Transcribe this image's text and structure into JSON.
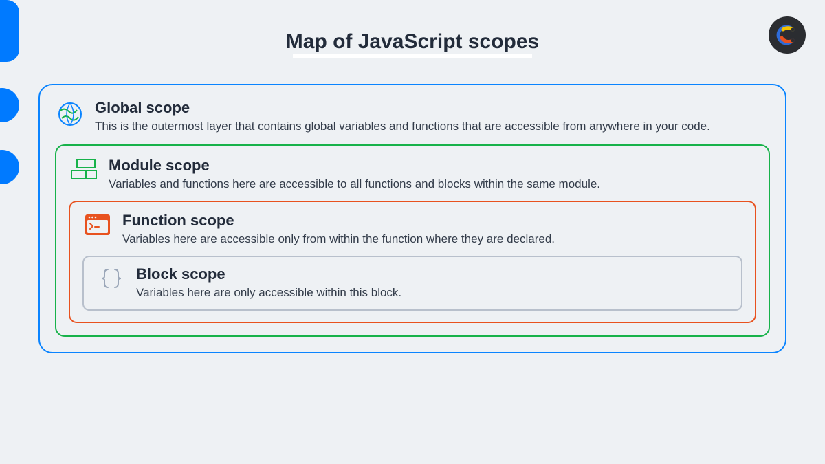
{
  "title": "Map of JavaScript scopes",
  "scopes": {
    "global": {
      "title": "Global scope",
      "desc": "This is the outermost layer that contains global variables and functions that are accessible from anywhere in your code.",
      "border_color": "#0a84ff"
    },
    "module": {
      "title": "Module scope",
      "desc": "Variables and functions here are accessible to all functions and blocks within the same module.",
      "border_color": "#17b24a"
    },
    "function": {
      "title": "Function scope",
      "desc": "Variables here are accessible only from within the function where they are declared.",
      "border_color": "#e8521f"
    },
    "block": {
      "title": "Block scope",
      "desc": "Variables here are only accessible within this block.",
      "border_color": "#b8c0cc"
    }
  }
}
